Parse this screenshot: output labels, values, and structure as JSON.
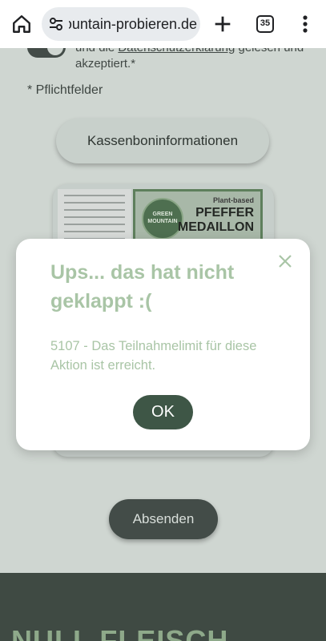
{
  "browser": {
    "url_text": "mountain-probieren.de",
    "tab_count": "35",
    "icons": [
      "home-icon",
      "site-settings-icon",
      "new-tab-icon",
      "tab-switcher-icon",
      "more-menu-icon"
    ]
  },
  "form": {
    "consent_prefix": "und die ",
    "consent_link": "Datenschutzerklärung",
    "consent_suffix": " gelesen und akzeptiert.*",
    "required_note": "* Pflichtfelder",
    "receipt_button": "Kassenboninformationen",
    "product_badge": "Plant-based",
    "product_name": "PFEFFER MEDAILLON",
    "product_logo": "GREEN MOUNTAIN",
    "submit_button": "Absenden"
  },
  "footer": {
    "wordmark": "NULL FLEISCH"
  },
  "modal": {
    "title": "Ups... das hat nicht geklappt :(",
    "message": "5107 - Das Teilnahmelimit für diese Aktion ist erreicht.",
    "ok_label": "OK"
  },
  "colors": {
    "overlay_bg": "#cfd6d1",
    "accent_dark": "#3e5646",
    "modal_text": "#a9c5a6"
  }
}
